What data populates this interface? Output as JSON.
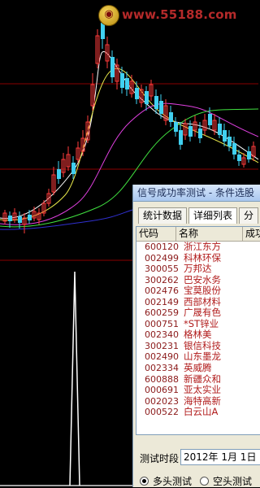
{
  "watermark": {
    "logo_text": "●",
    "url": "www.55188.com"
  },
  "dialog": {
    "title": "信号成功率测试 - 条件选股",
    "tabs": [
      "统计数据",
      "详细列表",
      "分"
    ],
    "active_tab": 1,
    "columns": [
      "代码",
      "名称",
      "成功"
    ],
    "rows": [
      {
        "code": "600120",
        "name": "浙江东方"
      },
      {
        "code": "002499",
        "name": "科林环保"
      },
      {
        "code": "300055",
        "name": "万邦达"
      },
      {
        "code": "300262",
        "name": "巴安水务"
      },
      {
        "code": "002476",
        "name": "宝莫股份"
      },
      {
        "code": "002149",
        "name": "西部材料"
      },
      {
        "code": "600259",
        "name": "广晟有色"
      },
      {
        "code": "000751",
        "name": "*ST锌业"
      },
      {
        "code": "002340",
        "name": "格林美"
      },
      {
        "code": "300231",
        "name": "银信科技"
      },
      {
        "code": "002490",
        "name": "山东墨龙"
      },
      {
        "code": "002334",
        "name": "英威腾"
      },
      {
        "code": "600888",
        "name": "新疆众和"
      },
      {
        "code": "000691",
        "name": "亚太实业"
      },
      {
        "code": "002023",
        "name": "海特高新"
      },
      {
        "code": "000522",
        "name": "白云山A"
      }
    ],
    "period_label": "测试时段",
    "date_value": "2012年 1月 1日",
    "radio_long": "多头测试",
    "radio_short": "空头测试",
    "selected_mode": "long"
  },
  "colors": {
    "background": "#000000",
    "candle_up": "#ff3b3b",
    "candle_down": "#40d0f0",
    "ma_white": "#ffffff",
    "ma_yellow": "#e8e84a",
    "ma_magenta": "#e040e0",
    "ma_green": "#40e040",
    "ma_blue": "#3030d0",
    "signal": "#ffffff",
    "divider": "#8a0000"
  }
}
